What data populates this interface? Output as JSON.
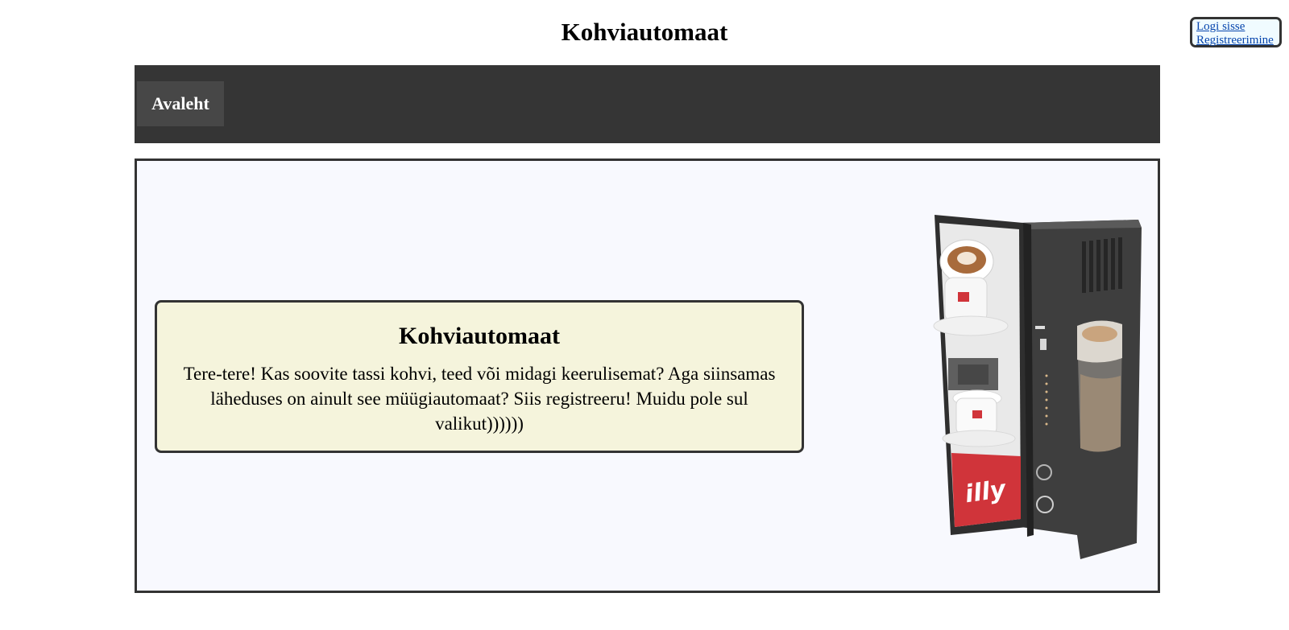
{
  "header": {
    "title": "Kohviautomaat"
  },
  "auth": {
    "login_label": "Logi sisse",
    "register_label": "Registreerimine"
  },
  "nav": {
    "items": [
      {
        "label": "Avaleht"
      }
    ]
  },
  "main": {
    "card": {
      "title": "Kohviautomaat",
      "text": "Tere-tere! Kas soovite tassi kohvi, teed või midagi keerulisemat? Aga siinsamas läheduses on ainult see müügiautomaat? Siis registreeru! Muidu pole sul valikut))))))"
    },
    "image": {
      "brand_text": "illy",
      "icon": "coffee-vending-machine-image"
    }
  },
  "colors": {
    "nav_background": "#353535",
    "nav_item_background": "#474747",
    "panel_background": "#f8f9fe",
    "card_background": "#f5f4dc",
    "border": "#333333",
    "link": "#0645ad",
    "brand_red": "#d0343a"
  }
}
